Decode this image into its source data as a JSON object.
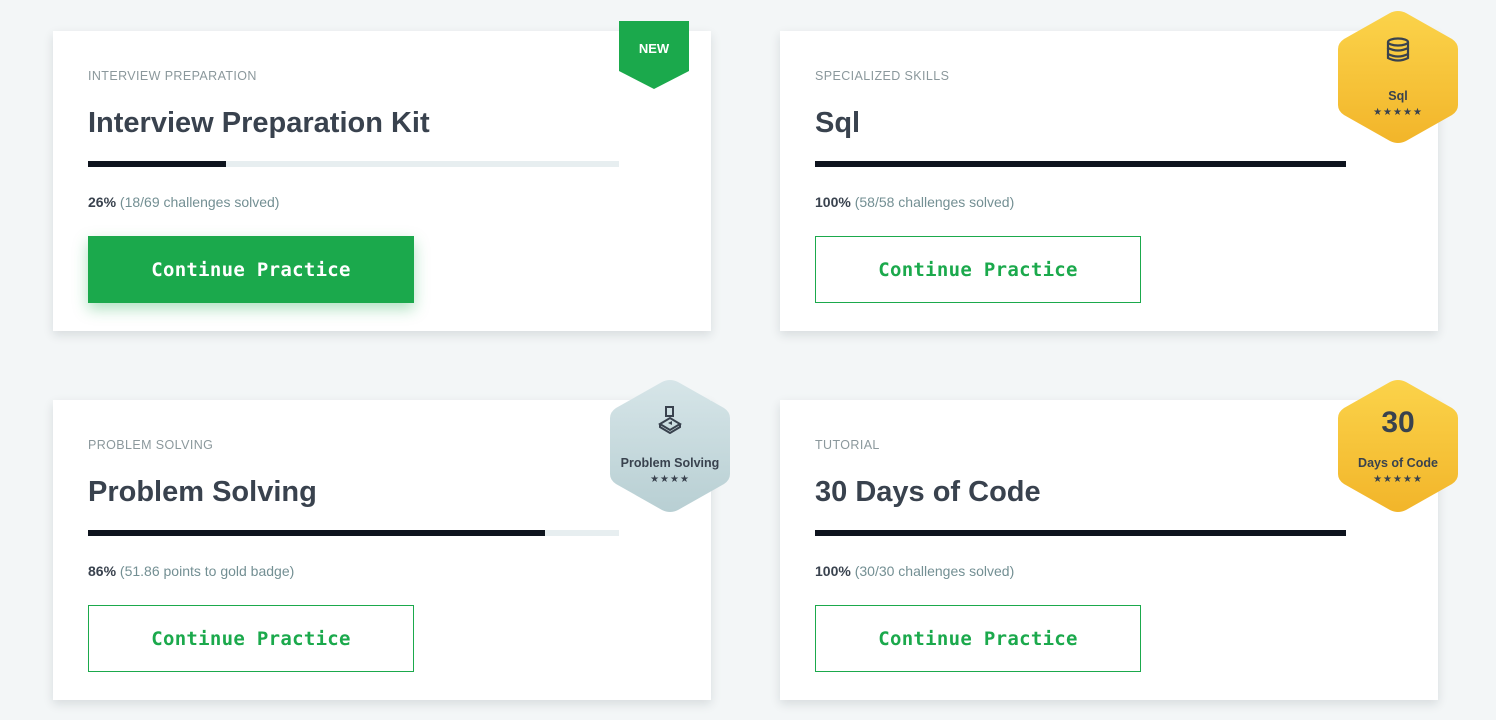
{
  "colors": {
    "accent_green": "#1ba94c",
    "progress_fill": "#0e141e",
    "progress_track": "#e7eef0",
    "gold_badge": "#f5c330",
    "silver_badge": "#c9dde0"
  },
  "cards": [
    {
      "category": "INTERVIEW PREPARATION",
      "title": "Interview Preparation Kit",
      "progress_fraction": 0.26,
      "percent_label": "26%",
      "progress_detail": "(18/69 challenges solved)",
      "button_label": "Continue Practice",
      "button_style": "primary",
      "ribbon": "NEW"
    },
    {
      "category": "SPECIALIZED SKILLS",
      "title": "Sql",
      "progress_fraction": 1.0,
      "percent_label": "100%",
      "progress_detail": "(58/58 challenges solved)",
      "button_label": "Continue Practice",
      "button_style": "outline",
      "badge": {
        "name": "Sql",
        "stars": "★★★★★",
        "icon": "database-icon",
        "tier": "gold"
      }
    },
    {
      "category": "PROBLEM SOLVING",
      "title": "Problem Solving",
      "progress_fraction": 0.86,
      "percent_label": "86%",
      "progress_detail": "(51.86 points to gold badge)",
      "button_label": "Continue Practice",
      "button_style": "outline",
      "badge": {
        "name": "Problem Solving",
        "stars": "★★★★",
        "icon": "blocks-icon",
        "tier": "silver"
      }
    },
    {
      "category": "TUTORIAL",
      "title": "30 Days of Code",
      "progress_fraction": 1.0,
      "percent_label": "100%",
      "progress_detail": "(30/30 challenges solved)",
      "button_label": "Continue Practice",
      "button_style": "outline",
      "badge": {
        "number": "30",
        "name": "Days of Code",
        "stars": "★★★★★",
        "tier": "gold"
      }
    }
  ]
}
